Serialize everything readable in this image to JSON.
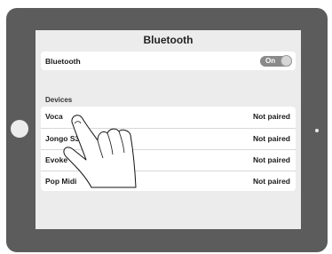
{
  "nav": {
    "title": "Bluetooth"
  },
  "bluetooth": {
    "label": "Bluetooth",
    "toggle": "On"
  },
  "devices": {
    "header": "Devices",
    "items": [
      {
        "name": "Voca",
        "status": "Not paired"
      },
      {
        "name": "Jongo S3",
        "status": "Not paired"
      },
      {
        "name": "Evoke",
        "status": "Not paired"
      },
      {
        "name": "Pop Midi",
        "status": "Not paired"
      }
    ]
  }
}
